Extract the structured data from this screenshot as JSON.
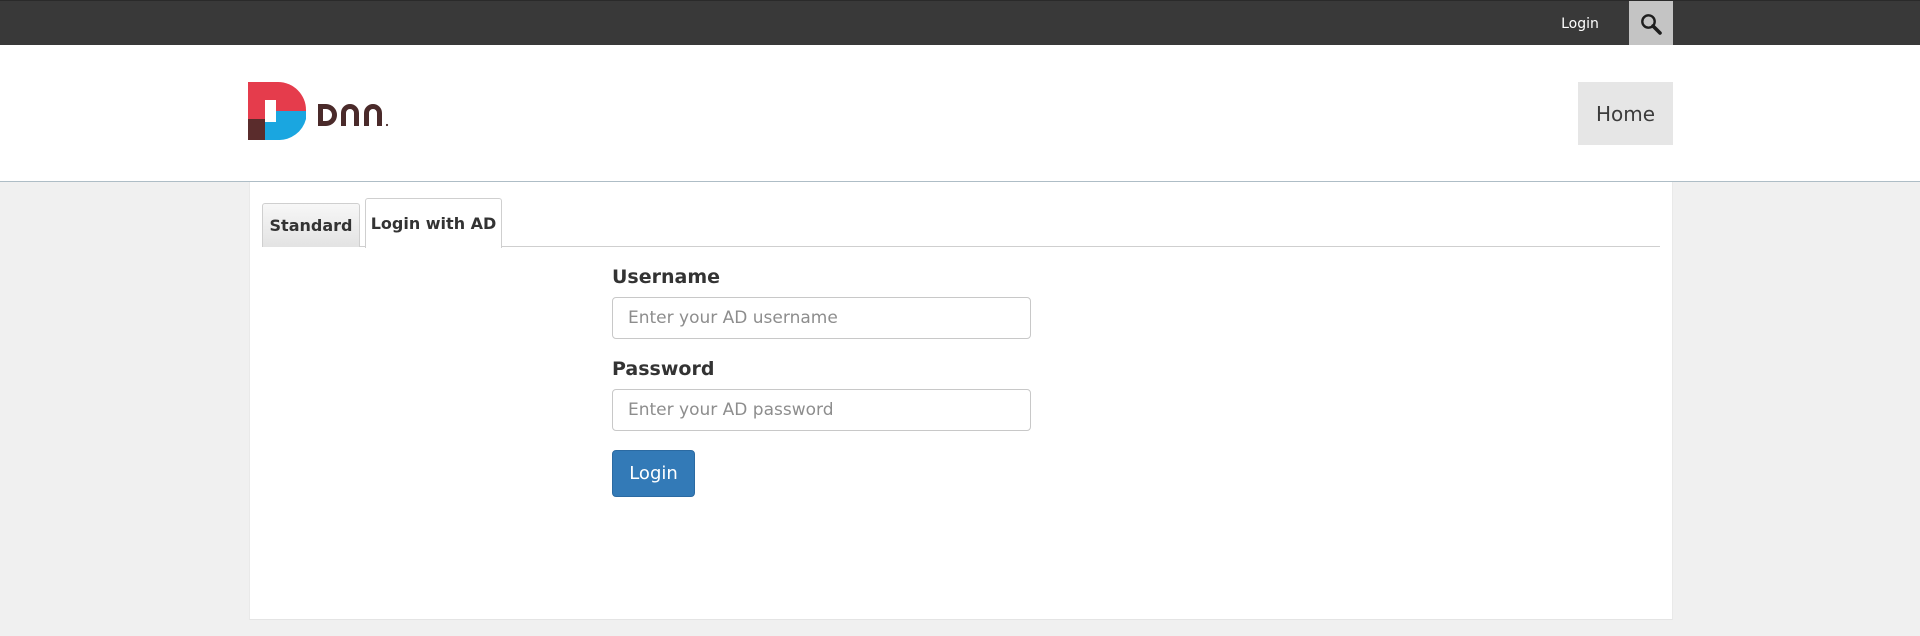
{
  "topbar": {
    "login_label": "Login",
    "search_icon": "search-icon",
    "background_color": "#393939"
  },
  "header": {
    "logo_text": "dnn",
    "nav": {
      "home_label": "Home"
    }
  },
  "tabs": [
    {
      "label": "Standard",
      "active": false
    },
    {
      "label": "Login with AD",
      "active": true
    }
  ],
  "form": {
    "username": {
      "label": "Username",
      "placeholder": "Enter your AD username",
      "value": ""
    },
    "password": {
      "label": "Password",
      "placeholder": "Enter your AD password",
      "value": ""
    },
    "submit_label": "Login",
    "accent_color": "#337ab7"
  }
}
